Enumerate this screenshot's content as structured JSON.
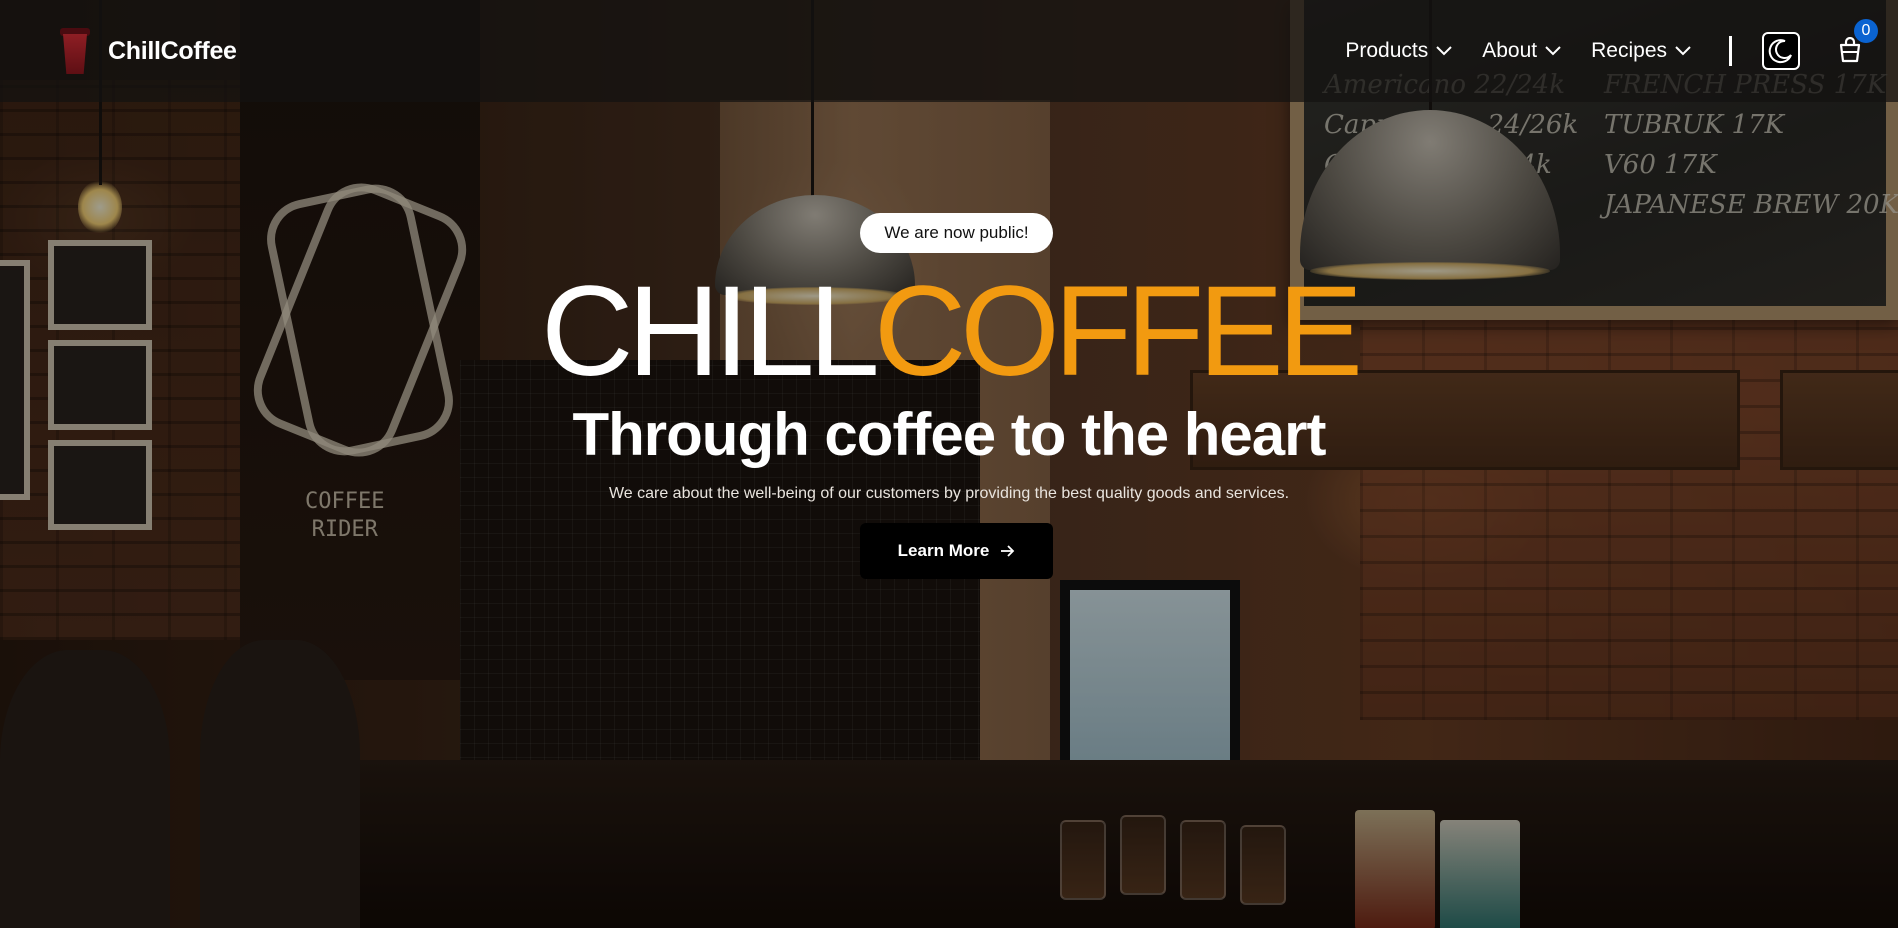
{
  "brand": {
    "name": "ChillCoffee",
    "logo_icon": "coffee-cup-logo-icon"
  },
  "nav": {
    "items": [
      {
        "label": "Products",
        "icon": "chevron-down-icon"
      },
      {
        "label": "About",
        "icon": "chevron-down-icon"
      },
      {
        "label": "Recipes",
        "icon": "chevron-down-icon"
      }
    ],
    "theme_toggle_icon": "moon-icon",
    "cart": {
      "icon": "shopping-cart-icon",
      "count": "0"
    }
  },
  "hero": {
    "badge": "We are now public!",
    "title_part1": "CHILL",
    "title_part2": "COFFEE",
    "subtitle": "Through coffee to the heart",
    "description": "We care about the well-being of our customers by providing the best quality goods and services.",
    "cta_label": "Learn More",
    "cta_icon": "arrow-right-icon"
  },
  "colors": {
    "accent": "#f29a10",
    "badge": "#0a63d1",
    "navbar": "#141210"
  }
}
